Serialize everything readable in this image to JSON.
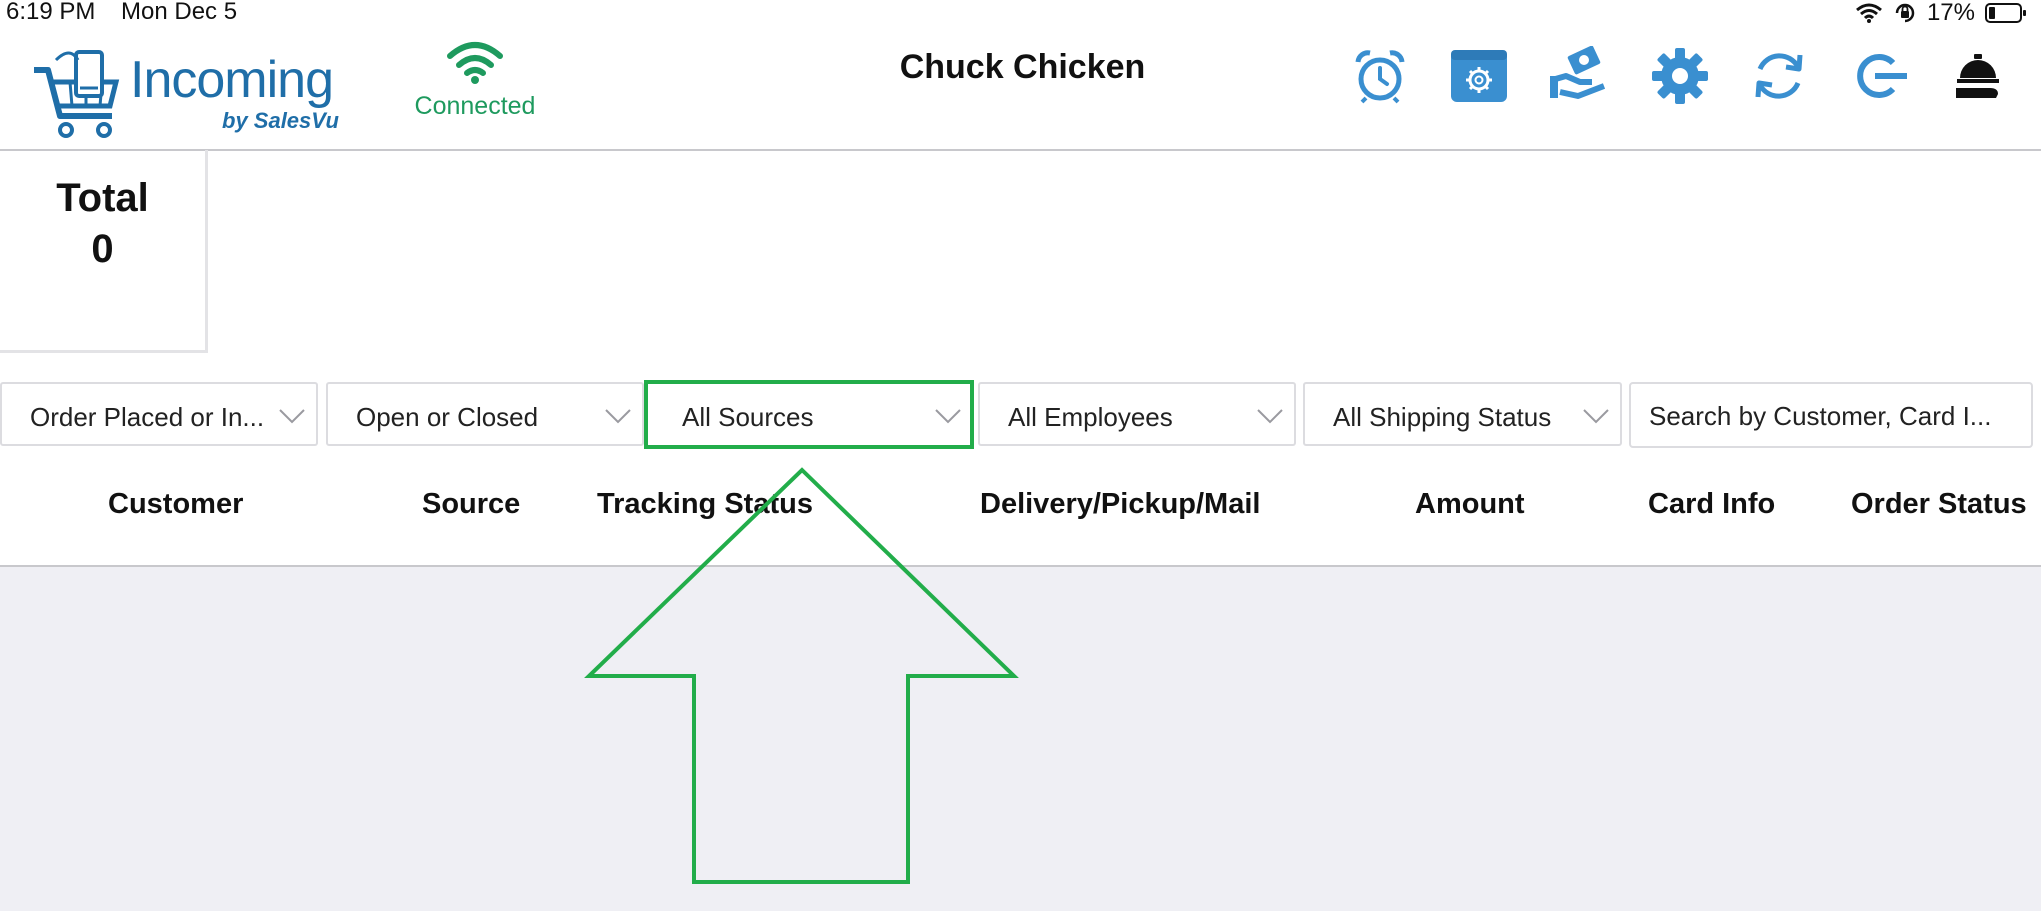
{
  "status_bar": {
    "time": "6:19 PM",
    "date": "Mon Dec 5",
    "battery": "17%",
    "icons": [
      "wifi-icon",
      "orientation-lock-icon",
      "battery-icon"
    ]
  },
  "header": {
    "app_name": "Incoming",
    "app_sub": "by SalesVu",
    "connection_status": "Connected",
    "store_name": "Chuck Chicken",
    "toolbar_icons": [
      "alarm-clock-icon",
      "store-settings-icon",
      "payment-hand-icon",
      "gear-icon",
      "refresh-icon",
      "logout-icon",
      "service-bell-icon"
    ]
  },
  "summary": {
    "label": "Total",
    "value": "0"
  },
  "filters": {
    "date_filter": "Order Placed or In...",
    "state_filter": "Open or Closed",
    "source_filter": "All Sources",
    "employee_filter": "All Employees",
    "shipping_filter": "All Shipping Status",
    "search_placeholder": "Search by Customer, Card I..."
  },
  "columns": [
    "Customer",
    "Source",
    "Tracking Status",
    "Delivery/Pickup/Mail",
    "Amount",
    "Card Info",
    "Order Status"
  ],
  "colors": {
    "brand_blue": "#1f6ea8",
    "icon_blue": "#3a8fd0",
    "connected_green": "#1e9a5e",
    "highlight_green": "#22ad4a",
    "list_background": "#efeff4"
  }
}
